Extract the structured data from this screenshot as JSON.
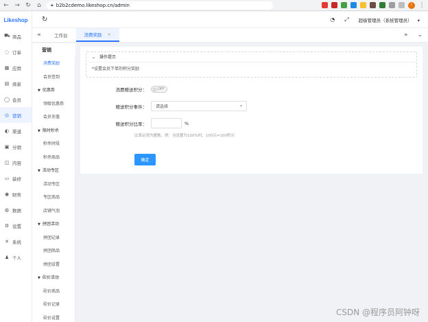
{
  "browser": {
    "url": "b2b2cdemo.likeshop.cn/admin",
    "profile_initial": "!"
  },
  "logo": "Likeshop",
  "rail": [
    {
      "label": "商品",
      "icon": "cart-icon",
      "glyph": "⛟"
    },
    {
      "label": "订单",
      "icon": "order-icon",
      "glyph": "◌"
    },
    {
      "label": "应用",
      "icon": "app-icon",
      "glyph": "▦"
    },
    {
      "label": "商家",
      "icon": "shop-icon",
      "glyph": "▤"
    },
    {
      "label": "会员",
      "icon": "user-icon",
      "glyph": "◯"
    },
    {
      "label": "营销",
      "icon": "marketing-icon",
      "glyph": "◎",
      "active": true
    },
    {
      "label": "渠道",
      "icon": "channel-icon",
      "glyph": "◐"
    },
    {
      "label": "分销",
      "icon": "distribution-icon",
      "glyph": "▣"
    },
    {
      "label": "内容",
      "icon": "content-icon",
      "glyph": "◫"
    },
    {
      "label": "装修",
      "icon": "decorate-icon",
      "glyph": "▭"
    },
    {
      "label": "财务",
      "icon": "finance-icon",
      "glyph": "◉"
    },
    {
      "label": "数据",
      "icon": "data-icon",
      "glyph": "◍"
    },
    {
      "label": "设置",
      "icon": "settings-icon",
      "glyph": "⚙"
    },
    {
      "label": "系统",
      "icon": "system-icon",
      "glyph": "✕"
    },
    {
      "label": "个人",
      "icon": "person-icon",
      "glyph": "♟"
    }
  ],
  "subnav": {
    "title": "营销",
    "items": [
      {
        "type": "item",
        "label": "消费奖励",
        "active": true
      },
      {
        "type": "item",
        "label": "会员签到"
      },
      {
        "type": "group",
        "label": "优惠券"
      },
      {
        "type": "item",
        "label": "领取优惠券"
      },
      {
        "type": "item",
        "label": "会员充值"
      },
      {
        "type": "group",
        "label": "限时秒杀"
      },
      {
        "type": "item",
        "label": "秒杀时段"
      },
      {
        "type": "item",
        "label": "秒杀商品"
      },
      {
        "type": "group",
        "label": "活动专区"
      },
      {
        "type": "item",
        "label": "活动专区"
      },
      {
        "type": "item",
        "label": "专区商品"
      },
      {
        "type": "item",
        "label": "店铺气泡"
      },
      {
        "type": "group",
        "label": "拼团活动"
      },
      {
        "type": "item",
        "label": "拼团记录"
      },
      {
        "type": "item",
        "label": "拼团商品"
      },
      {
        "type": "item",
        "label": "拼团设置"
      },
      {
        "type": "group",
        "label": "砍价活动"
      },
      {
        "type": "item",
        "label": "砍价商品"
      },
      {
        "type": "item",
        "label": "砍价记录"
      },
      {
        "type": "item",
        "label": "砍价设置"
      }
    ]
  },
  "topbar": {
    "user": "超级管理员（系统管理员）"
  },
  "tabs": [
    {
      "label": "工作台"
    },
    {
      "label": "消费奖励",
      "active": true,
      "close": "×"
    }
  ],
  "tip": {
    "title": "操作提示",
    "body": "*设置会员下单的积分奖励"
  },
  "form": {
    "enable_label": "消费赠送积分：",
    "enable_state": "OFF",
    "event_label": "赠送积分事件：",
    "event_placeholder": "请选择",
    "ratio_label": "赠送积分比率：",
    "ratio_unit": "%",
    "hint": "比率必须为整数。例：当设置为100%时，100元=100积分",
    "submit": "确定"
  },
  "watermark": "CSDN @程序员阿钟呀"
}
